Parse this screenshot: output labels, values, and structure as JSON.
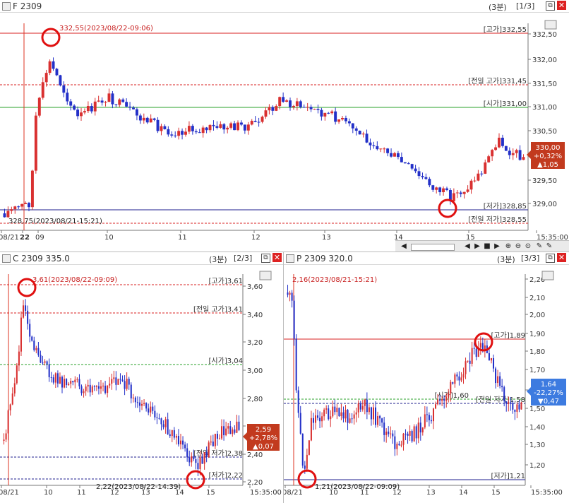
{
  "top": {
    "title": "F 2309",
    "interval": "(3분)",
    "pager": "[1/3]",
    "top_label": "332,55(2023/08/22-09:06)",
    "bottom_label": "328,75(2023/08/21-15:21)",
    "refs": {
      "high": "[고가]332,55",
      "prev_high": "[전일 고가]331,45",
      "open": "[시가]331,00",
      "low": "[저가]328,85",
      "prev_low": "[전일 저가]328,55"
    },
    "y_ticks": [
      "332,50",
      "332,00",
      "331,50",
      "331,00",
      "330,50",
      "330,00",
      "329,50",
      "329,00"
    ],
    "x_labels": [
      "08/21",
      "22",
      "09",
      "10",
      "11",
      "12",
      "13",
      "14",
      "15",
      "15:35:00"
    ],
    "badge": {
      "price": "330,00",
      "pct": "+0,32%",
      "chg": "▲1,05"
    }
  },
  "left": {
    "title": "C 2309 335.0",
    "interval": "(3분)",
    "pager": "[2/3]",
    "top_label": "3,61(2023/08/22-09:09)",
    "bottom_label": "2,22(2023/08/22-14:39)",
    "refs": {
      "high": "[고가]3,61",
      "prev_high": "[전일 고가]3,41",
      "open": "[시가]3,04",
      "prev_low": "[전일 저가]2,38",
      "low": "[저가]2,22"
    },
    "y_ticks": [
      "3,60",
      "3,40",
      "3,20",
      "3,00",
      "2,80",
      "2,60",
      "2,40",
      "2,20"
    ],
    "x_labels": [
      "08/21",
      "10",
      "11",
      "12",
      "13",
      "14",
      "15",
      "15:35:00"
    ],
    "badge": {
      "price": "2,59",
      "pct": "+2,78%",
      "chg": "▲0,07"
    }
  },
  "right": {
    "title": "P 2309 320.0",
    "interval": "(3분)",
    "pager": "[3/3]",
    "top_label": "2,16(2023/08/21-15:21)",
    "bottom_label": "1,21(2023/08/22-09:09)",
    "refs": {
      "high": "[고가]1,89",
      "open": "[시가]1,60",
      "prev_low": "[전일 저가]1,58",
      "low": "[저가]1,21"
    },
    "y_ticks": [
      "2,20",
      "2,10",
      "2,00",
      "1,90",
      "1,80",
      "1,70",
      "1,60",
      "1,50",
      "1,40",
      "1,30",
      "1,20"
    ],
    "x_labels": [
      "08/21",
      "10",
      "11",
      "12",
      "13",
      "14",
      "15",
      "15:35:00"
    ],
    "badge": {
      "price": "1,64",
      "pct": "-22,27%",
      "chg": "▼0,47"
    }
  },
  "colors": {
    "up": "#d93030",
    "down": "#2330c8",
    "high_line": "#d92020",
    "prev_line": "#d92020",
    "open_line": "#2aa02a",
    "low_line": "#1f1f8f",
    "badge_up": "#c23a1e",
    "badge_down": "#3d7be0"
  },
  "icons": [
    "restore-icon",
    "close-icon",
    "chart-type-icon",
    "scroll-left-icon",
    "scroll-right-icon",
    "play-icon",
    "stop-icon",
    "next-icon",
    "zoom-in-icon",
    "zoom-out-icon",
    "zoom-reset-icon",
    "settings-icon"
  ]
}
